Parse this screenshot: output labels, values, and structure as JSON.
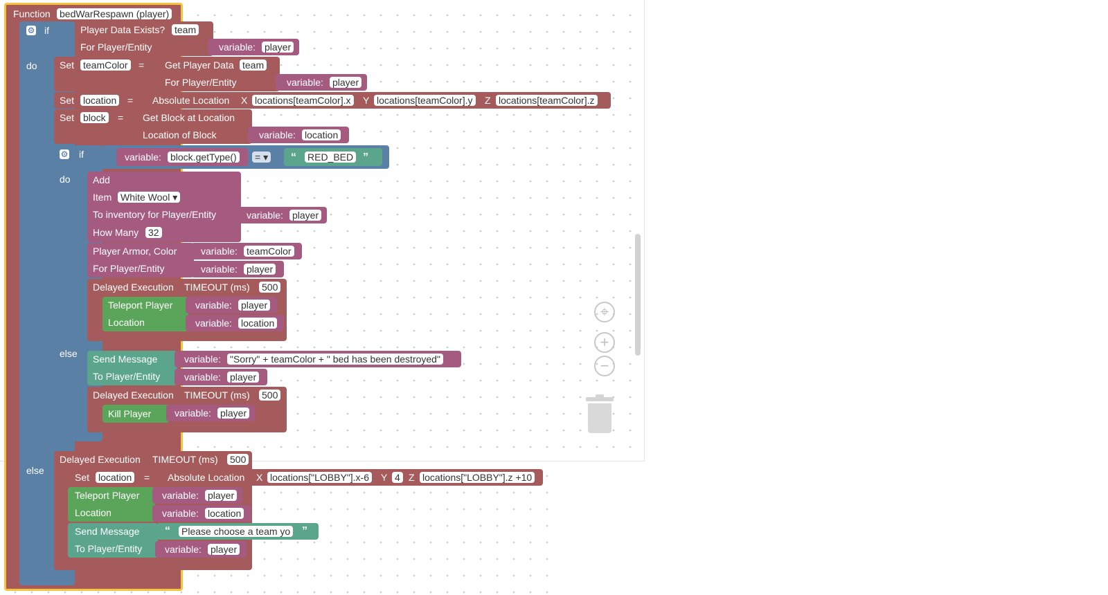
{
  "function_block": {
    "keyword": "Function",
    "name": "bedWarRespawn (player)"
  },
  "if_outer": {
    "if_label": "if",
    "do_label": "do",
    "else_label": "else",
    "condition": {
      "label": "Player Data Exists?",
      "key": "team",
      "for_label": "For Player/Entity",
      "var_prefix": "variable:",
      "var_value": "player"
    }
  },
  "set_team_color": {
    "set_label": "Set",
    "var": "teamColor",
    "eq": "=",
    "get_label": "Get Player Data",
    "key": "team",
    "for_label": "For Player/Entity",
    "var_prefix": "variable:",
    "var_value": "player"
  },
  "set_location": {
    "set_label": "Set",
    "var": "location",
    "eq": "=",
    "abs_label": "Absolute Location",
    "x_label": "X",
    "x_value": "locations[teamColor].x",
    "y_label": "Y",
    "y_value": "locations[teamColor].y",
    "z_label": "Z",
    "z_value": "locations[teamColor].z"
  },
  "set_block": {
    "set_label": "Set",
    "var": "block",
    "eq": "=",
    "get_label": "Get Block at Location",
    "loc_label": "Location of Block",
    "var_prefix": "variable:",
    "var_value": "location"
  },
  "if_inner": {
    "if_label": "if",
    "do_label": "do",
    "else_label": "else",
    "cond_var_prefix": "variable:",
    "cond_var_value": "block.getType()",
    "operator": "= ▾",
    "open_quote": "“",
    "string_value": "RED_BED",
    "close_quote": "”"
  },
  "add_item": {
    "add_label": "Add",
    "item_label": "Item",
    "item_value": "White Wool ▾",
    "to_label": "To inventory for Player/Entity",
    "var_prefix": "variable:",
    "var_value": "player",
    "how_many_label": "How Many",
    "how_many_value": "32"
  },
  "armor": {
    "label": "Player Armor, Color",
    "var_prefix": "variable:",
    "var_value": "teamColor",
    "for_label": "For Player/Entity",
    "for_var_prefix": "variable:",
    "for_var_value": "player"
  },
  "delayed_1": {
    "label": "Delayed Execution",
    "timeout_label": "TIMEOUT (ms)",
    "timeout_value": "500"
  },
  "teleport_1": {
    "label": "Teleport Player",
    "var_prefix": "variable:",
    "var_value": "player",
    "loc_label": "Location",
    "loc_var_prefix": "variable:",
    "loc_var_value": "location"
  },
  "send_msg_1": {
    "label": "Send Message",
    "var_prefix": "variable:",
    "var_value": "\"Sorry\" + teamColor + \" bed has been destroyed\"",
    "to_label": "To Player/Entity",
    "to_var_prefix": "variable:",
    "to_var_value": "player"
  },
  "delayed_2": {
    "label": "Delayed Execution",
    "timeout_label": "TIMEOUT (ms)",
    "timeout_value": "500"
  },
  "kill": {
    "label": "Kill Player",
    "var_prefix": "variable:",
    "var_value": "player"
  },
  "delayed_3": {
    "label": "Delayed Execution",
    "timeout_label": "TIMEOUT (ms)",
    "timeout_value": "500"
  },
  "set_location_2": {
    "set_label": "Set",
    "var": "location",
    "eq": "=",
    "abs_label": "Absolute Location",
    "x_label": "X",
    "x_value": "locations[\"LOBBY\"].x-6",
    "y_label": "Y",
    "y_value": "4",
    "z_label": "Z",
    "z_value": "locations[\"LOBBY\"].z +10"
  },
  "teleport_2": {
    "label": "Teleport Player",
    "var_prefix": "variable:",
    "var_value": "player",
    "loc_label": "Location",
    "loc_var_prefix": "variable:",
    "loc_var_value": "location"
  },
  "send_msg_2": {
    "label": "Send Message",
    "open_quote": "“",
    "string_value": "Please choose a team yo",
    "close_quote": "”",
    "to_label": "To Player/Entity",
    "to_var_prefix": "variable:",
    "to_var_value": "player"
  },
  "controls": {
    "recenter_icon": "⌖",
    "zoom_in_icon": "+",
    "zoom_out_icon": "−",
    "gear_icon": "⚙"
  },
  "colors": {
    "logic_blue": "#5b80a5",
    "action_red": "#a55b5b",
    "data_pink": "#a55b80",
    "player_green": "#5ba55b",
    "text_teal": "#5ba58c",
    "function_outline": "#f7c33c"
  }
}
